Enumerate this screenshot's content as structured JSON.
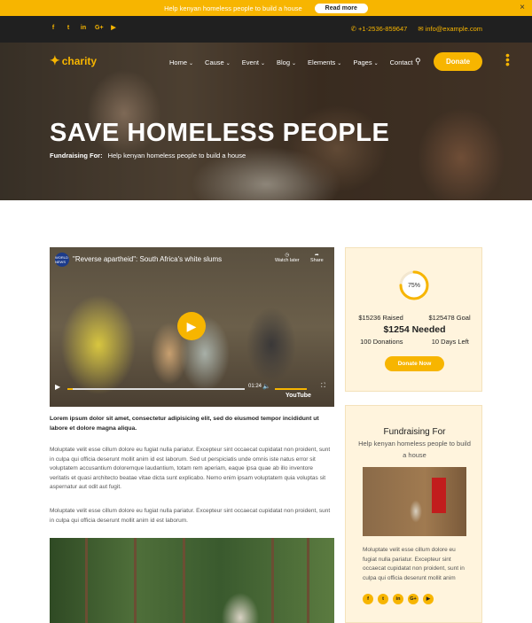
{
  "announcement": {
    "text": "Help kenyan homeless people to build a house",
    "button": "Read more",
    "close": "×"
  },
  "social": {
    "icons": [
      "facebook-icon",
      "twitter-icon",
      "linkedin-icon",
      "google-plus-icon",
      "youtube-icon"
    ],
    "glyphs": [
      "f",
      "t",
      "in",
      "G+",
      "▶"
    ]
  },
  "contact": {
    "phone": "+1-2536-859647",
    "email": "info@example.com"
  },
  "logo": {
    "text": "charity"
  },
  "menu": [
    {
      "label": "Home",
      "caret": true
    },
    {
      "label": "Cause",
      "caret": true
    },
    {
      "label": "Event",
      "caret": true
    },
    {
      "label": "Blog",
      "caret": true
    },
    {
      "label": "Elements",
      "caret": true
    },
    {
      "label": "Pages",
      "caret": true
    },
    {
      "label": "Contact",
      "caret": false
    }
  ],
  "nav": {
    "donate": "Donate"
  },
  "hero": {
    "title": "SAVE HOMELESS PEOPLE",
    "sub_label": "Fundraising For:",
    "sub_value": "Help kenyan homeless people to build a house"
  },
  "video": {
    "title": "\"Reverse apartheid\": South Africa's white slums",
    "channel": "WORLD NEWS",
    "watch_later": "Watch later",
    "share": "Share",
    "time": "01:24",
    "brand": "YouTube",
    "progress": 0.03
  },
  "article": {
    "lead": "Lorem ipsum dolor sit amet, consectetur adipisicing elit, sed do eiusmod tempor incididunt ut labore et dolore magna aliqua.",
    "p1": "Moluptate velit esse cillum dolore eu fugiat nulla pariatur. Excepteur sint occaecat cupidatat non proident, sunt in culpa qui officia deserunt mollit anim id est laborum. Sed ut perspiciatis unde omnis iste natus error sit voluptatem accusantium doloremque laudantium, totam rem aperiam, eaque ipsa quae ab illo inventore veritatis et quasi architecto beatae vitae dicta sunt explicabo. Nemo enim ipsam voluptatem quia voluptas sit aspernatur aut odit aut fugit.",
    "p2": "Moluptate velit esse cillum dolore eu fugiat nulla pariatur. Excepteur sint occaecat cupidatat non proident, sunt in culpa qui officia deserunt mollit anim id est laborum."
  },
  "progress": {
    "percent": 75,
    "label": "75%",
    "raised": "$15236 Raised",
    "goal": "$125478 Goal",
    "needed": "$1254 Needed",
    "donations": "100 Donations",
    "days_left": "10 Days Left",
    "button": "Donate Now"
  },
  "sidebar": {
    "title": "Fundraising For",
    "subtitle": "Help kenyan homeless people to build a house",
    "text": "Moluptate velit esse cillum dolore eu fugiat nulla pariatur. Excepteur sint occaecat cupidatat non proident, sunt in culpa qui officia deserunt mollit anim"
  },
  "colors": {
    "accent": "#f7b500",
    "dark": "#202020",
    "card_bg": "#fff4dd"
  }
}
